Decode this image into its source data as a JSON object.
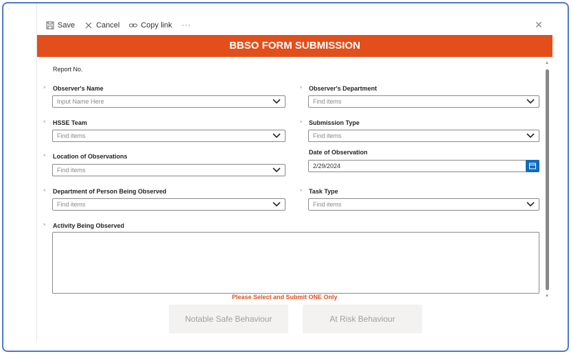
{
  "toolbar": {
    "save_label": "Save",
    "cancel_label": "Cancel",
    "copylink_label": "Copy link",
    "more_label": "···"
  },
  "close_glyph": "✕",
  "form_title": "BBSO FORM SUBMISSION",
  "fields": {
    "report_no": {
      "label": "Report No."
    },
    "observer_name": {
      "label": "Observer's Name",
      "placeholder": "Input Name Here"
    },
    "observer_department": {
      "label": "Observer's Department",
      "placeholder": "Find items"
    },
    "hsse_team": {
      "label": "HSSE Team",
      "placeholder": "Find items"
    },
    "submission_type": {
      "label": "Submission Type",
      "placeholder": "Find items"
    },
    "location": {
      "label": "Location of Observations",
      "placeholder": "Find items"
    },
    "date_of_observation": {
      "label": "Date of Observation",
      "value": "2/29/2024"
    },
    "department_observed": {
      "label": "Department of Person Being Observed",
      "placeholder": "Find items"
    },
    "task_type": {
      "label": "Task Type",
      "placeholder": "Find items"
    },
    "activity": {
      "label": "Activity Being Observed"
    }
  },
  "required_marker": "*",
  "notice": "Please Select and Submit ONE Only",
  "buttons": {
    "safe": "Notable Safe Behaviour",
    "risk": "At Risk Behaviour"
  },
  "colors": {
    "banner": "#e24f1b",
    "accent": "#0f6cbd",
    "frame": "#4a78c8"
  }
}
